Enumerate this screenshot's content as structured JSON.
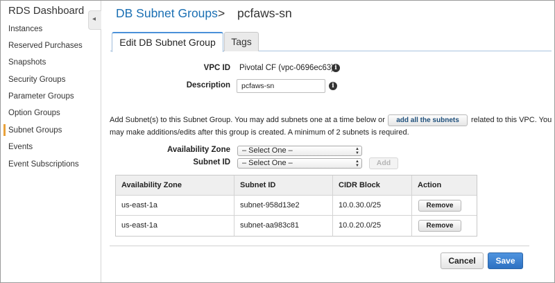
{
  "sidebar": {
    "title": "RDS Dashboard",
    "collapse_glyph": "◂",
    "items": [
      {
        "label": "Instances"
      },
      {
        "label": "Reserved Purchases"
      },
      {
        "label": "Snapshots"
      },
      {
        "label": "Security Groups"
      },
      {
        "label": "Parameter Groups"
      },
      {
        "label": "Option Groups"
      },
      {
        "label": "Subnet Groups",
        "active": true
      },
      {
        "label": "Events"
      },
      {
        "label": "Event Subscriptions"
      }
    ]
  },
  "breadcrumb": {
    "link": "DB Subnet Groups",
    "separator": ">",
    "current": "pcfaws-sn"
  },
  "tabs": [
    {
      "label": "Edit DB Subnet Group",
      "active": true
    },
    {
      "label": "Tags",
      "active": false
    }
  ],
  "form": {
    "vpc_label": "VPC ID",
    "vpc_value": "Pivotal CF (vpc-0696ec63)",
    "description_label": "Description",
    "description_value": "pcfaws-sn",
    "info_glyph": "i"
  },
  "instructions": {
    "line1_before": "Add Subnet(s) to this Subnet Group. You may add subnets one at a time below or",
    "add_all_button": "add all the subnets",
    "line1_after": "related to this VPC. You",
    "line2": "may make additions/edits after this group is created. A minimum of 2 subnets is required."
  },
  "subnet_picker": {
    "az_label": "Availability Zone",
    "az_selected": "– Select One –",
    "subnet_label": "Subnet ID",
    "subnet_selected": "– Select One –",
    "add_button": "Add"
  },
  "table": {
    "headers": [
      "Availability Zone",
      "Subnet ID",
      "CIDR Block",
      "Action"
    ],
    "rows": [
      {
        "az": "us-east-1a",
        "subnet": "subnet-958d13e2",
        "cidr": "10.0.30.0/25",
        "action": "Remove"
      },
      {
        "az": "us-east-1a",
        "subnet": "subnet-aa983c81",
        "cidr": "10.0.20.0/25",
        "action": "Remove"
      }
    ]
  },
  "footer": {
    "cancel": "Cancel",
    "save": "Save"
  },
  "colors": {
    "link": "#1a6fb3",
    "primary_button": "#2d71c2",
    "active_marker": "#e8a13a"
  }
}
